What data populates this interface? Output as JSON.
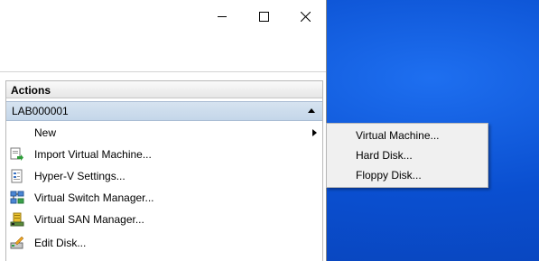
{
  "window": {
    "controls": {
      "minimize": "minimize-icon",
      "maximize": "maximize-icon",
      "close": "close-icon"
    }
  },
  "actions": {
    "header": "Actions",
    "node_label": "LAB000001",
    "items": [
      {
        "label": "New",
        "icon": "none",
        "has_submenu": true
      },
      {
        "label": "Import Virtual Machine...",
        "icon": "import-vm-icon"
      },
      {
        "label": "Hyper-V Settings...",
        "icon": "settings-document-icon"
      },
      {
        "label": "Virtual Switch Manager...",
        "icon": "network-switch-icon"
      },
      {
        "label": "Virtual SAN Manager...",
        "icon": "san-manager-icon"
      },
      {
        "label": "Edit Disk...",
        "icon": "edit-disk-icon"
      }
    ]
  },
  "submenu": {
    "items": [
      {
        "label": "Virtual Machine..."
      },
      {
        "label": "Hard Disk..."
      },
      {
        "label": "Floppy Disk..."
      }
    ]
  },
  "colors": {
    "desktop": "#0a4fd0",
    "node_header": "#c4d6e9",
    "menu_bg": "#f0f0f0"
  }
}
